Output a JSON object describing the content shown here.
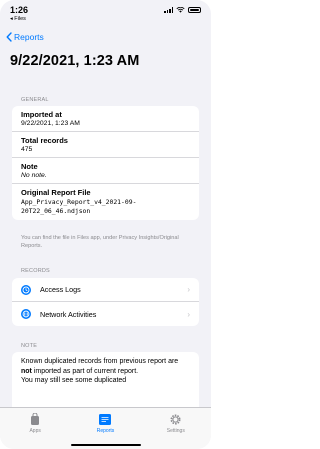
{
  "status": {
    "time": "1:26",
    "back_app": "◂ Files"
  },
  "nav": {
    "back_label": "Reports",
    "title": "9/22/2021, 1:23 AM"
  },
  "general": {
    "header": "GENERAL",
    "imported_label": "Imported at",
    "imported_value": "9/22/2021, 1:23 AM",
    "total_label": "Total records",
    "total_value": "475",
    "note_label": "Note",
    "note_value": "No note.",
    "file_label": "Original Report File",
    "file_value": "App_Privacy_Report_v4_2021-09-20T22_06_46.ndjson",
    "footer": "You can find the file in Files app, under Privacy Insights/Original Reports."
  },
  "records": {
    "header": "RECORDS",
    "items": [
      {
        "label": "Access Logs",
        "icon": "clock-icon"
      },
      {
        "label": "Network Activities",
        "icon": "globe-icon"
      }
    ]
  },
  "note": {
    "header": "NOTE",
    "text_1": "Known duplicated records from previous report are ",
    "text_bold": "not",
    "text_2": " imported as part of current report.",
    "text_3": "You may still see some duplicated"
  },
  "tabs": [
    {
      "label": "Apps",
      "icon": "apps-icon",
      "active": false
    },
    {
      "label": "Reports",
      "icon": "reports-icon",
      "active": true
    },
    {
      "label": "Settings",
      "icon": "gear-icon",
      "active": false
    }
  ],
  "colors": {
    "accent": "#007aff",
    "background": "#f2f2f7",
    "secondary_text": "#8a8a8e"
  }
}
